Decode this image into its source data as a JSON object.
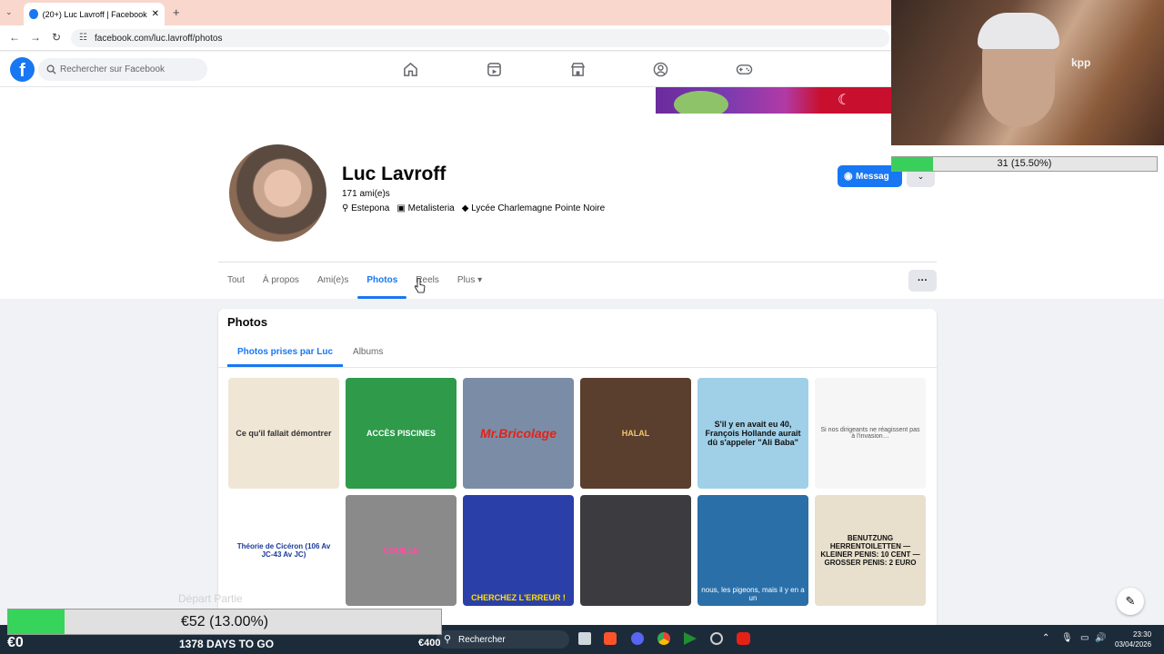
{
  "browser": {
    "tab_title": "(20+) Luc Lavroff | Facebook",
    "url": "facebook.com/luc.lavroff/photos",
    "new_tab": "+"
  },
  "fb": {
    "search_placeholder": "Rechercher sur Facebook",
    "nav_icons": [
      "home-icon",
      "reels-icon",
      "marketplace-icon",
      "profile-icon",
      "gaming-icon"
    ],
    "brand_color": "#1877f2"
  },
  "profile": {
    "name": "Luc Lavroff",
    "friends": "171 ami(e)s",
    "location": "Estepona",
    "work": "Metalisteria",
    "school": "Lycée Charlemagne Pointe Noire",
    "message_label": "Messag",
    "tabs": [
      {
        "label": "Tout"
      },
      {
        "label": "À propos"
      },
      {
        "label": "Ami(e)s"
      },
      {
        "label": "Photos",
        "active": true
      },
      {
        "label": "Reels"
      },
      {
        "label": "Plus ▾"
      }
    ],
    "more_label": "···"
  },
  "photos": {
    "title": "Photos",
    "subtabs": [
      {
        "label": "Photos prises par Luc",
        "active": true
      },
      {
        "label": "Albums"
      }
    ],
    "items": [
      {
        "caption": "Ce qu'il fallait démontrer",
        "bg": "#efe6d6",
        "fg": "#333"
      },
      {
        "caption": "ACCÈS PISCINES",
        "bg": "#2e9a4a",
        "fg": "#fff"
      },
      {
        "caption": "Mr.Bricolage",
        "bg": "#7b8da6",
        "fg": "#e2231a"
      },
      {
        "caption": "HALAL",
        "bg": "#5a3e2e",
        "fg": "#f2c66d"
      },
      {
        "caption": "S'il y en avait eu 40, François Hollande aurait dû s'appeler \"Ali Baba\"",
        "bg": "#9fd0e8",
        "fg": "#111"
      },
      {
        "caption": "Si nos dirigeants ne réagissent pas à l'invasion…",
        "bg": "#f6f6f6",
        "fg": "#555"
      },
      {
        "caption": "Théorie de Cicéron (106 Av JC-43 Av JC)",
        "bg": "#ffffff",
        "fg": "#1a3a9a"
      },
      {
        "caption": "COUILLE",
        "bg": "#8a8a8a",
        "fg": "#ff4fa0"
      },
      {
        "caption": "CHERCHEZ L'ERREUR !",
        "bg": "#2b3fa8",
        "fg": "#ffe000"
      },
      {
        "caption": "",
        "bg": "#3b3b40",
        "fg": "#fff"
      },
      {
        "caption": "nous, les pigeons, mais il y en a un",
        "bg": "#2a6fa8",
        "fg": "#fff"
      },
      {
        "caption": "BENUTZUNG HERRENTOILETTEN — KLEINER PENIS: 10 CENT — GROSSER PENIS: 2 EURO",
        "bg": "#e8e0cc",
        "fg": "#111"
      }
    ]
  },
  "overlay": {
    "goal_small": "31 (15.50%)",
    "goal_small_progress": 0.155,
    "goal_big": "€52 (13.00%)",
    "goal_big_progress": 0.13,
    "start_amount": "€0",
    "days_left": "1378 DAYS TO GO",
    "depart_label": "Départ Partie",
    "webcam_text": "kpp",
    "success_color": "#36d45a"
  },
  "taskbar": {
    "search_label": "Rechercher",
    "money_badge": "€400",
    "time": "23:30",
    "date": "03/04/2026"
  }
}
